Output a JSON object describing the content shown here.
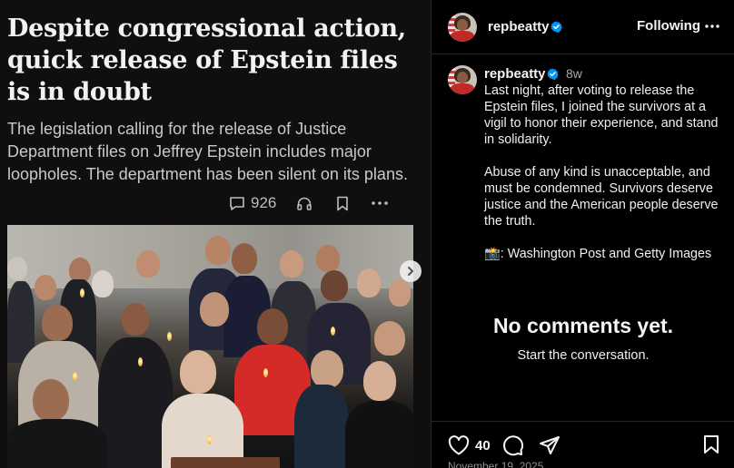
{
  "article": {
    "headline": "Despite congressional action, quick release of Epstein files is in doubt",
    "dek": "The legislation calling for the release of Justice Department files on Jeffrey Epstein includes major loopholes. The department has been silent on its plans.",
    "comment_count": "926",
    "icons": [
      "comment-icon",
      "headphones-icon",
      "bookmark-icon",
      "more-icon"
    ]
  },
  "post": {
    "username": "repbeatty",
    "follow_status": "Following",
    "time_ago": "8w",
    "caption": "Last night, after voting to release the Epstein files, I joined the survivors at a vigil to honor their experience, and stand in solidarity.\n\nAbuse of any kind is unacceptable, and must be condemned. Survivors deserve justice and the American people deserve the truth.\n\n📸: Washington Post and Getty Images",
    "likes": "40",
    "date": "November 19, 2025"
  },
  "comments": {
    "empty_title": "No comments yet.",
    "empty_subtitle": "Start the conversation."
  },
  "colors": {
    "background": "#000000",
    "verified": "#0095f6",
    "muted": "#a8a8a8"
  }
}
